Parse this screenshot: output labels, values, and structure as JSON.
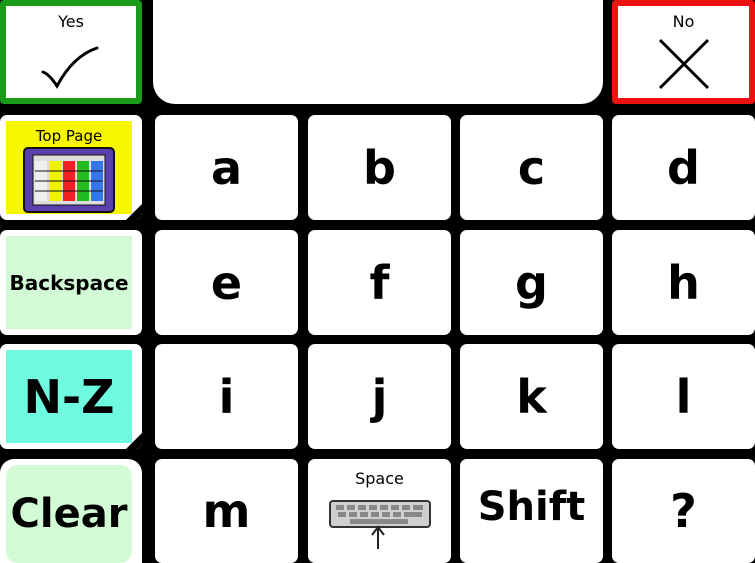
{
  "top": {
    "yes_label": "Yes",
    "no_label": "No",
    "message": ""
  },
  "side": {
    "top_page": "Top Page",
    "backspace": "Backspace",
    "nz": "N-Z",
    "clear": "Clear"
  },
  "keys": {
    "a": "a",
    "b": "b",
    "c": "c",
    "d": "d",
    "e": "e",
    "f": "f",
    "g": "g",
    "h": "h",
    "i": "i",
    "j": "j",
    "k": "k",
    "l": "l",
    "m": "m",
    "space": "Space",
    "shift": "Shift",
    "question": "?"
  },
  "colors": {
    "yes_border": "#1a9a1a",
    "no_border": "#ee1111",
    "top_page_bg": "#f7f700",
    "backspace_bg": "#d2fbd6",
    "nz_bg": "#6ffbdf",
    "clear_bg": "#d2fbd6"
  },
  "icons": {
    "yes": "checkmark-icon",
    "no": "x-mark-icon",
    "top_page": "calendar-grid-icon",
    "space": "keyboard-spacebar-icon"
  }
}
